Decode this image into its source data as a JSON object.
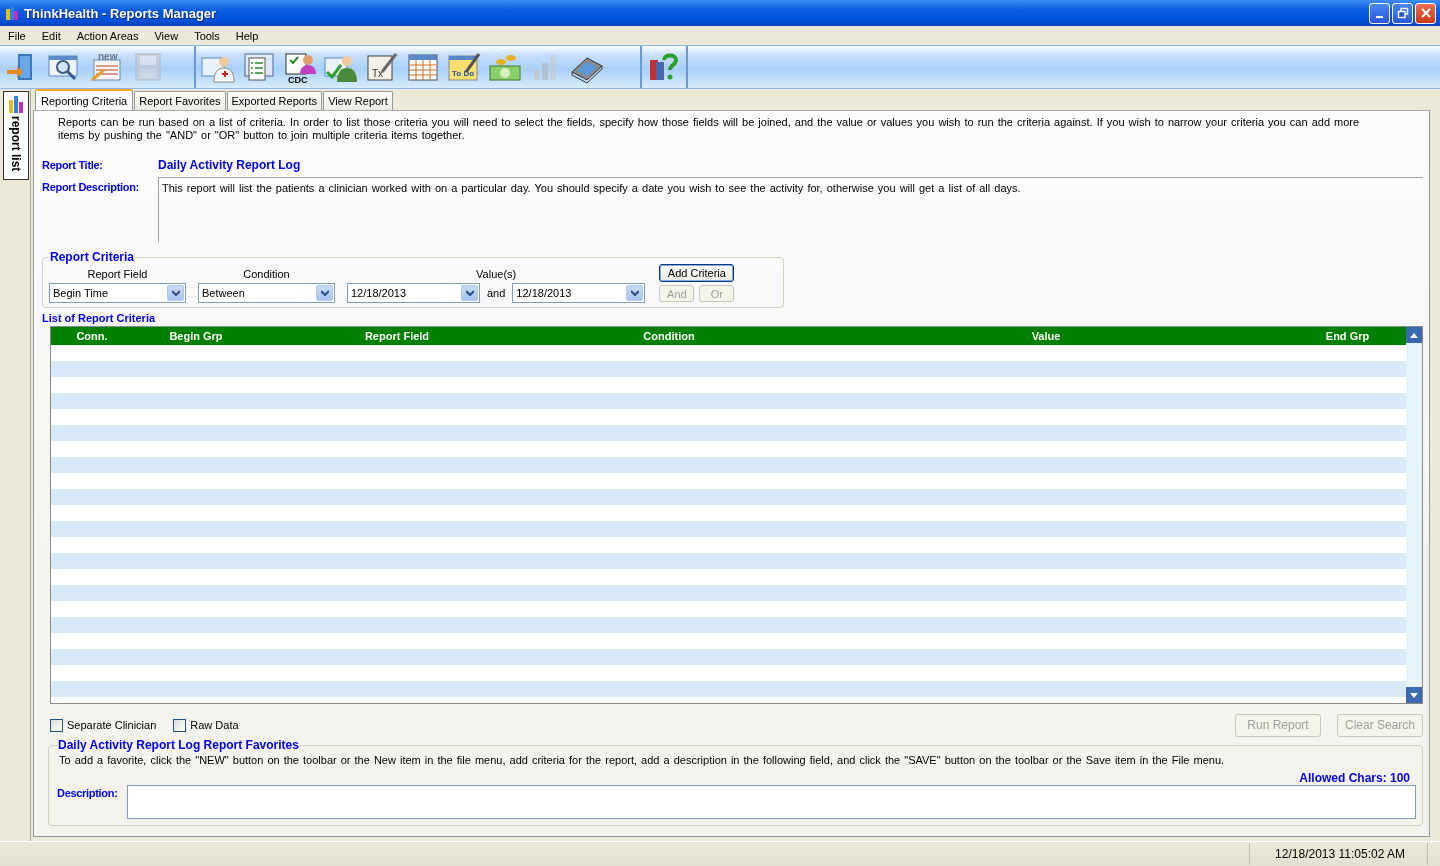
{
  "window": {
    "title": "ThinkHealth - Reports Manager"
  },
  "menu": [
    "File",
    "Edit",
    "Action Areas",
    "View",
    "Tools",
    "Help"
  ],
  "toolbar": [
    [
      {
        "kind": "exit",
        "disabled": false
      },
      {
        "kind": "search",
        "disabled": false
      },
      {
        "kind": "new",
        "label": "new",
        "disabled": false
      },
      {
        "kind": "save",
        "disabled": true
      }
    ],
    [
      {
        "kind": "patient",
        "disabled": false
      },
      {
        "kind": "clipboard",
        "disabled": false
      },
      {
        "kind": "cdc",
        "label": "CDC",
        "disabled": false
      },
      {
        "kind": "person-check",
        "disabled": false
      },
      {
        "kind": "treatment",
        "label": "Tx",
        "disabled": false
      },
      {
        "kind": "calendar",
        "disabled": false
      },
      {
        "kind": "todo",
        "label": "To Do",
        "disabled": false
      },
      {
        "kind": "money",
        "disabled": false
      },
      {
        "kind": "chart",
        "disabled": true
      },
      {
        "kind": "scanner",
        "disabled": false
      }
    ],
    [
      {
        "kind": "help",
        "disabled": false
      }
    ]
  ],
  "side_tab": {
    "label": "report list"
  },
  "tabs": [
    {
      "label": "Reporting Criteria",
      "selected": true
    },
    {
      "label": "Report Favorites",
      "selected": false
    },
    {
      "label": "Exported Reports",
      "selected": false
    },
    {
      "label": "View Report",
      "selected": false
    }
  ],
  "intro": "Reports can be run based on a list of criteria.  In order to list those criteria you will need to select the fields, specify how those fields will be joined, and the value or values you wish to run the criteria against.  If you wish to narrow your criteria you can add more items by pushing the \"AND\" or \"OR\" button to join multiple criteria items together.",
  "report_title": {
    "label": "Report Title:",
    "value": "Daily Activity Report Log"
  },
  "report_description": {
    "label": "Report Description:",
    "value": "This report will list the patients a clinician worked with on a particular day. You should specify a date you wish to see the activity for, otherwise you will get a list of all days."
  },
  "criteria": {
    "title": "Report Criteria",
    "field": {
      "label": "Report Field",
      "value": "Begin Time"
    },
    "condition": {
      "label": "Condition",
      "value": "Between"
    },
    "values": {
      "label": "Value(s)",
      "from": "12/18/2013",
      "joiner": "and",
      "to": "12/18/2013"
    },
    "buttons": [
      {
        "label": "Add Criteria",
        "disabled": false
      },
      {
        "label": "And",
        "disabled": true
      },
      {
        "label": "Or",
        "disabled": true
      }
    ]
  },
  "criteria_list": {
    "title": "List of Report Criteria",
    "columns": [
      "Conn.",
      "Begin Grp",
      "Report Field",
      "Condition",
      "Value",
      "End Grp"
    ]
  },
  "options": [
    {
      "label": "Separate Clinician",
      "checked": false
    },
    {
      "label": "Raw Data",
      "checked": false
    }
  ],
  "actions": [
    {
      "label": "Run Report",
      "disabled": true
    },
    {
      "label": "Clear Search",
      "disabled": true
    }
  ],
  "favorites": {
    "title": "Daily Activity Report Log Report Favorites",
    "instructions": "To add a favorite, click the \"NEW\" button on the toolbar or the New item in the file menu, add criteria for the report, add a description in the following field, and click the \"SAVE\" button on the toolbar or the Save item in the File menu.",
    "allowed_chars": "Allowed Chars: 100",
    "description_label": "Description:"
  },
  "status_bar": {
    "datetime": "12/18/2013 11:05:02 AM"
  }
}
